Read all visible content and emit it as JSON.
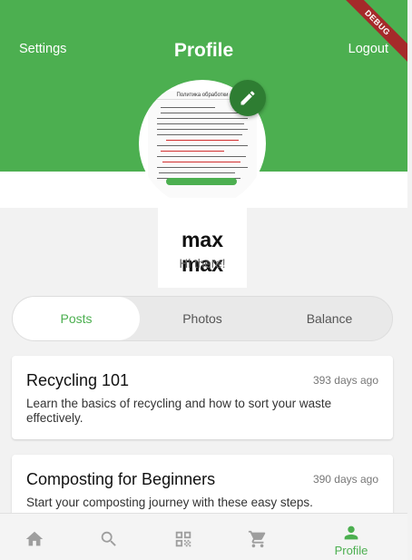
{
  "header": {
    "settings_label": "Settings",
    "title": "Profile",
    "logout_label": "Logout",
    "debug_label": "DEBUG"
  },
  "profile": {
    "name": "max max",
    "bio": "Hi there!",
    "avatar_doc_title": "Политика обработки"
  },
  "tabs": [
    {
      "label": "Posts",
      "active": true
    },
    {
      "label": "Photos",
      "active": false
    },
    {
      "label": "Balance",
      "active": false
    }
  ],
  "posts": [
    {
      "title": "Recycling 101",
      "time": "393 days ago",
      "body": "Learn the basics of recycling and how to sort your waste effectively."
    },
    {
      "title": "Composting for Beginners",
      "time": "390 days ago",
      "body": "Start your composting journey with these easy steps."
    }
  ],
  "bottom_nav": {
    "items": [
      {
        "icon": "home-icon"
      },
      {
        "icon": "search-icon"
      },
      {
        "icon": "qr-code-icon"
      },
      {
        "icon": "cart-icon"
      },
      {
        "icon": "person-icon",
        "label": "Profile",
        "active": true
      }
    ]
  },
  "colors": {
    "primary": "#4caf50",
    "fab": "#2e7d32",
    "debug_banner": "#a52a2a",
    "inactive_icon": "#9e9e9e"
  }
}
